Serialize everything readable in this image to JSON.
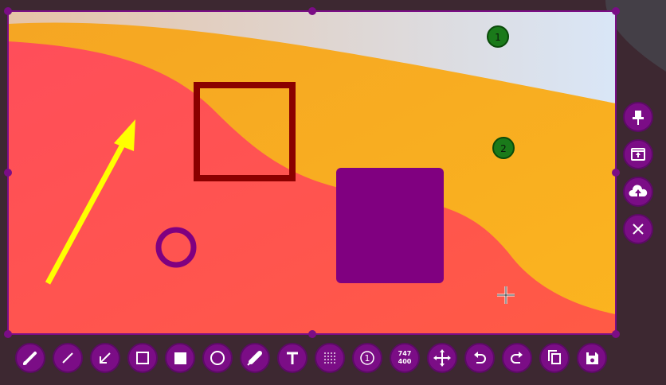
{
  "colors": {
    "accent": "#7b0d86",
    "accent_border": "#5c0a66",
    "arrow": "#ffff00",
    "rect_outline": "#8b0000",
    "filled_rect": "#800080",
    "ellipse": "#800080",
    "badge": "#1a7a1a"
  },
  "annotations": {
    "badges": [
      {
        "label": "1"
      },
      {
        "label": "2"
      }
    ]
  },
  "toolbar": {
    "items": [
      {
        "icon": "pencil-icon"
      },
      {
        "icon": "line-icon"
      },
      {
        "icon": "arrow-icon"
      },
      {
        "icon": "rectangle-icon"
      },
      {
        "icon": "filled-rectangle-icon"
      },
      {
        "icon": "ellipse-icon"
      },
      {
        "icon": "marker-icon"
      },
      {
        "icon": "text-icon"
      },
      {
        "icon": "blur-icon"
      },
      {
        "icon": "number-icon",
        "label": "1"
      },
      {
        "icon": "size-readout",
        "width": "747",
        "height": "400"
      },
      {
        "icon": "move-icon"
      },
      {
        "icon": "undo-icon"
      },
      {
        "icon": "redo-icon"
      },
      {
        "icon": "copy-icon"
      },
      {
        "icon": "save-icon"
      }
    ]
  },
  "side_toolbar": {
    "items": [
      {
        "icon": "pin-icon"
      },
      {
        "icon": "open-in-app-icon"
      },
      {
        "icon": "upload-cloud-icon"
      },
      {
        "icon": "close-icon"
      }
    ]
  }
}
